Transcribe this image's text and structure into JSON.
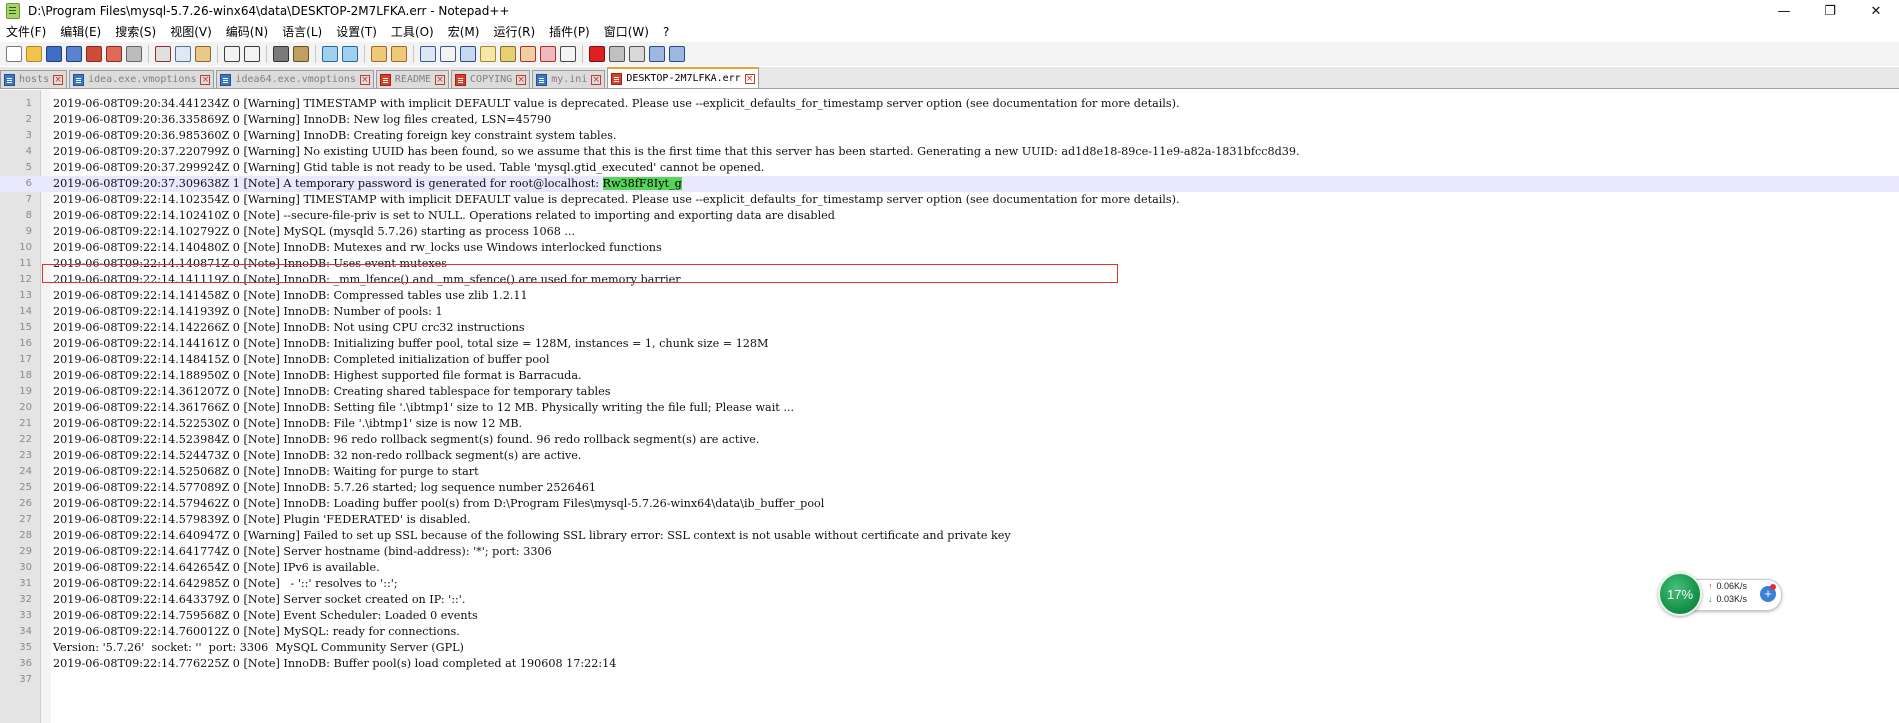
{
  "window": {
    "title": "D:\\Program Files\\mysql-5.7.26-winx64\\data\\DESKTOP-2M7LFKA.err - Notepad++",
    "minimize": "—",
    "maximize": "❐",
    "close": "✕"
  },
  "menu": {
    "items": [
      {
        "label": "文件(F)"
      },
      {
        "label": "编辑(E)"
      },
      {
        "label": "搜索(S)"
      },
      {
        "label": "视图(V)"
      },
      {
        "label": "编码(N)"
      },
      {
        "label": "语言(L)"
      },
      {
        "label": "设置(T)"
      },
      {
        "label": "工具(O)"
      },
      {
        "label": "宏(M)"
      },
      {
        "label": "运行(R)"
      },
      {
        "label": "插件(P)"
      },
      {
        "label": "窗口(W)"
      },
      {
        "label": "?"
      }
    ]
  },
  "toolbar": {
    "buttons": [
      {
        "name": "new-file-icon",
        "color": "#ffffff",
        "border": "#7a7a7a"
      },
      {
        "name": "open-file-icon",
        "color": "#f2c24b",
        "border": "#b08a20"
      },
      {
        "name": "save-icon",
        "color": "#3d6ec9",
        "border": "#223e78"
      },
      {
        "name": "save-all-icon",
        "color": "#5a82d0",
        "border": "#223e78"
      },
      {
        "name": "close-file-icon",
        "color": "#d04a3a",
        "border": "#8a2a20"
      },
      {
        "name": "close-all-icon",
        "color": "#e06a5a",
        "border": "#8a2a20"
      },
      {
        "name": "print-icon",
        "color": "#bcbcbc",
        "border": "#666666"
      },
      {
        "sep": true
      },
      {
        "name": "cut-icon",
        "color": "#e0e0e0",
        "border": "#8a3030"
      },
      {
        "name": "copy-icon",
        "color": "#dfe8f6",
        "border": "#5a6f96"
      },
      {
        "name": "paste-icon",
        "color": "#e8c98a",
        "border": "#8a6a30"
      },
      {
        "sep": true
      },
      {
        "name": "undo-icon",
        "color": "#f3f3f3",
        "border": "#3d3d3d"
      },
      {
        "name": "redo-icon",
        "color": "#f3f3f3",
        "border": "#3d3d3d"
      },
      {
        "sep": true
      },
      {
        "name": "find-icon",
        "color": "#7a7a7a",
        "border": "#333333"
      },
      {
        "name": "replace-icon",
        "color": "#c0a060",
        "border": "#6a5020"
      },
      {
        "sep": true
      },
      {
        "name": "zoom-in-icon",
        "color": "#9fd0f0",
        "border": "#2a6a9a"
      },
      {
        "name": "zoom-out-icon",
        "color": "#9fd0f0",
        "border": "#2a6a9a"
      },
      {
        "sep": true
      },
      {
        "name": "sync-vertical-icon",
        "color": "#f0c878",
        "border": "#a06a20"
      },
      {
        "name": "sync-horizontal-icon",
        "color": "#f0c878",
        "border": "#a06a20"
      },
      {
        "sep": true
      },
      {
        "name": "word-wrap-icon",
        "color": "#dbe6f6",
        "border": "#3d5a90"
      },
      {
        "name": "show-all-characters-icon",
        "color": "#f3f3f3",
        "border": "#3d5a90"
      },
      {
        "name": "indent-guide-icon",
        "color": "#c8d8f0",
        "border": "#2a4a8a"
      },
      {
        "name": "user-defined-language-icon",
        "color": "#f6e6a8",
        "border": "#a08a30"
      },
      {
        "name": "document-map-icon",
        "color": "#e8d070",
        "border": "#8a7020"
      },
      {
        "name": "function-list-icon",
        "color": "#f0d0a0",
        "border": "#b03030"
      },
      {
        "name": "folder-as-workspace-icon",
        "color": "#f0b8b8",
        "border": "#b03030"
      },
      {
        "name": "monitoring-icon",
        "color": "#f3f3f3",
        "border": "#4a4a4a"
      },
      {
        "sep": true
      },
      {
        "name": "record-macro-icon",
        "color": "#e02020",
        "border": "#7a1010"
      },
      {
        "name": "stop-recording-icon",
        "color": "#c0c0c0",
        "border": "#555555"
      },
      {
        "name": "play-macro-icon",
        "color": "#d8d8d8",
        "border": "#555555"
      },
      {
        "name": "run-macro-multiple-icon",
        "color": "#9db8e0",
        "border": "#2a4a8a"
      },
      {
        "name": "save-macro-icon",
        "color": "#9db8e0",
        "border": "#2a4a8a"
      }
    ]
  },
  "tabs": [
    {
      "label": "hosts",
      "modified": false,
      "active": false
    },
    {
      "label": "idea.exe.vmoptions",
      "modified": false,
      "active": false
    },
    {
      "label": "idea64.exe.vmoptions",
      "modified": false,
      "active": false
    },
    {
      "label": "README",
      "modified": true,
      "active": false
    },
    {
      "label": "COPYING",
      "modified": true,
      "active": false
    },
    {
      "label": "my.ini",
      "modified": false,
      "active": false
    },
    {
      "label": "DESKTOP-2M7LFKA.err",
      "modified": true,
      "active": true
    }
  ],
  "editor": {
    "current_line": 6,
    "highlighted_password": "Rw38fF8Iyt_g",
    "lines": [
      "2019-06-08T09:20:34.441234Z 0 [Warning] TIMESTAMP with implicit DEFAULT value is deprecated. Please use --explicit_defaults_for_timestamp server option (see documentation for more details).",
      "2019-06-08T09:20:36.335869Z 0 [Warning] InnoDB: New log files created, LSN=45790",
      "2019-06-08T09:20:36.985360Z 0 [Warning] InnoDB: Creating foreign key constraint system tables.",
      "2019-06-08T09:20:37.220799Z 0 [Warning] No existing UUID has been found, so we assume that this is the first time that this server has been started. Generating a new UUID: ad1d8e18-89ce-11e9-a82a-1831bfcc8d39.",
      "2019-06-08T09:20:37.299924Z 0 [Warning] Gtid table is not ready to be used. Table 'mysql.gtid_executed' cannot be opened.",
      "2019-06-08T09:20:37.309638Z 1 [Note] A temporary password is generated for root@localhost: ",
      "2019-06-08T09:22:14.102354Z 0 [Warning] TIMESTAMP with implicit DEFAULT value is deprecated. Please use --explicit_defaults_for_timestamp server option (see documentation for more details).",
      "2019-06-08T09:22:14.102410Z 0 [Note] --secure-file-priv is set to NULL. Operations related to importing and exporting data are disabled",
      "2019-06-08T09:22:14.102792Z 0 [Note] MySQL (mysqld 5.7.26) starting as process 1068 ...",
      "2019-06-08T09:22:14.140480Z 0 [Note] InnoDB: Mutexes and rw_locks use Windows interlocked functions",
      "2019-06-08T09:22:14.140871Z 0 [Note] InnoDB: Uses event mutexes",
      "2019-06-08T09:22:14.141119Z 0 [Note] InnoDB: _mm_lfence() and _mm_sfence() are used for memory barrier",
      "2019-06-08T09:22:14.141458Z 0 [Note] InnoDB: Compressed tables use zlib 1.2.11",
      "2019-06-08T09:22:14.141939Z 0 [Note] InnoDB: Number of pools: 1",
      "2019-06-08T09:22:14.142266Z 0 [Note] InnoDB: Not using CPU crc32 instructions",
      "2019-06-08T09:22:14.144161Z 0 [Note] InnoDB: Initializing buffer pool, total size = 128M, instances = 1, chunk size = 128M",
      "2019-06-08T09:22:14.148415Z 0 [Note] InnoDB: Completed initialization of buffer pool",
      "2019-06-08T09:22:14.188950Z 0 [Note] InnoDB: Highest supported file format is Barracuda.",
      "2019-06-08T09:22:14.361207Z 0 [Note] InnoDB: Creating shared tablespace for temporary tables",
      "2019-06-08T09:22:14.361766Z 0 [Note] InnoDB: Setting file '.\\ibtmp1' size to 12 MB. Physically writing the file full; Please wait ...",
      "2019-06-08T09:22:14.522530Z 0 [Note] InnoDB: File '.\\ibtmp1' size is now 12 MB.",
      "2019-06-08T09:22:14.523984Z 0 [Note] InnoDB: 96 redo rollback segment(s) found. 96 redo rollback segment(s) are active.",
      "2019-06-08T09:22:14.524473Z 0 [Note] InnoDB: 32 non-redo rollback segment(s) are active.",
      "2019-06-08T09:22:14.525068Z 0 [Note] InnoDB: Waiting for purge to start",
      "2019-06-08T09:22:14.577089Z 0 [Note] InnoDB: 5.7.26 started; log sequence number 2526461",
      "2019-06-08T09:22:14.579462Z 0 [Note] InnoDB: Loading buffer pool(s) from D:\\Program Files\\mysql-5.7.26-winx64\\data\\ib_buffer_pool",
      "2019-06-08T09:22:14.579839Z 0 [Note] Plugin 'FEDERATED' is disabled.",
      "2019-06-08T09:22:14.640947Z 0 [Warning] Failed to set up SSL because of the following SSL library error: SSL context is not usable without certificate and private key",
      "2019-06-08T09:22:14.641774Z 0 [Note] Server hostname (bind-address): '*'; port: 3306",
      "2019-06-08T09:22:14.642654Z 0 [Note] IPv6 is available.",
      "2019-06-08T09:22:14.642985Z 0 [Note]   - '::' resolves to '::';",
      "2019-06-08T09:22:14.643379Z 0 [Note] Server socket created on IP: '::'.",
      "2019-06-08T09:22:14.759568Z 0 [Note] Event Scheduler: Loaded 0 events",
      "2019-06-08T09:22:14.760012Z 0 [Note] MySQL: ready for connections.",
      "Version: '5.7.26'  socket: ''  port: 3306  MySQL Community Server (GPL)",
      "2019-06-08T09:22:14.776225Z 0 [Note] InnoDB: Buffer pool(s) load completed at 190608 17:22:14",
      ""
    ]
  },
  "net_monitor": {
    "cpu_percent": "17%",
    "upload": "0.06K/s",
    "download": "0.03K/s",
    "upload_arrow": "↑",
    "download_arrow": "↓",
    "plus": "+"
  }
}
